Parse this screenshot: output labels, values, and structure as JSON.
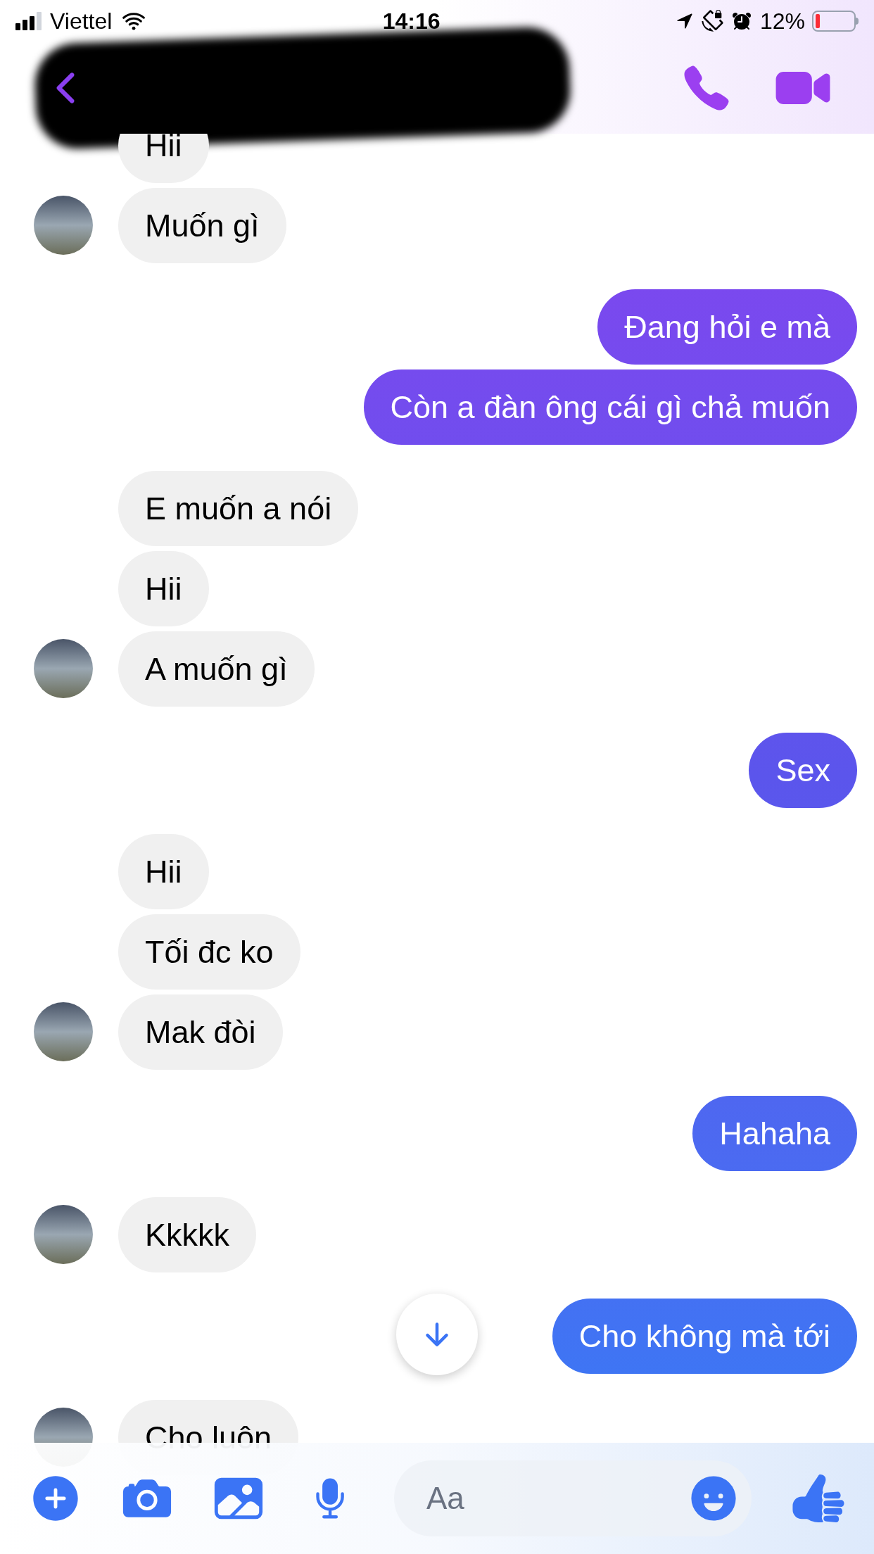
{
  "status_bar": {
    "carrier": "Viettel",
    "time": "14:16",
    "battery": "12%"
  },
  "messages": [
    {
      "kind": "received",
      "text": "Hii",
      "avatar": false
    },
    {
      "kind": "received",
      "text": "Muốn gì",
      "avatar": true
    },
    {
      "kind": "sent",
      "text": "Đang hỏi e mà"
    },
    {
      "kind": "sent",
      "text": "Còn a đàn ông cái gì chả muốn"
    },
    {
      "kind": "received",
      "text": "E muốn a nói",
      "avatar": false
    },
    {
      "kind": "received",
      "text": "Hii",
      "avatar": false
    },
    {
      "kind": "received",
      "text": "A muốn gì",
      "avatar": true
    },
    {
      "kind": "sent",
      "text": "Sex"
    },
    {
      "kind": "received",
      "text": "Hii",
      "avatar": false
    },
    {
      "kind": "received",
      "text": "Tối đc ko",
      "avatar": false
    },
    {
      "kind": "received",
      "text": "Mak đòi",
      "avatar": true
    },
    {
      "kind": "sent",
      "text": "Hahaha"
    },
    {
      "kind": "received",
      "text": "Kkkkk",
      "avatar": true
    },
    {
      "kind": "sent",
      "text": "Cho không mà tới"
    },
    {
      "kind": "received",
      "text": "Cho luôn",
      "avatar": true
    }
  ],
  "composer": {
    "placeholder": "Aa"
  }
}
